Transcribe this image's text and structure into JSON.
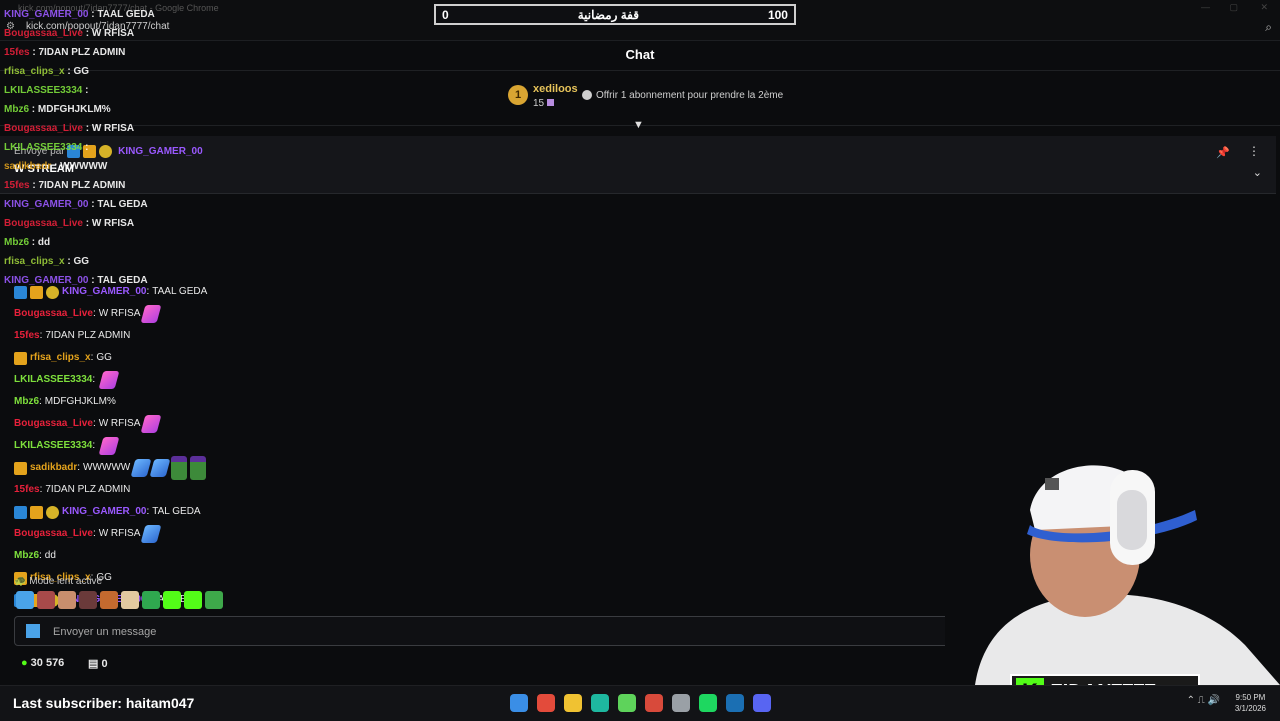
{
  "browser": {
    "title": "kick.com/popout/7idan7777/chat - Google Chrome",
    "url": "kick.com/popout/7idan7777/chat"
  },
  "goal": {
    "left": "0",
    "title": "قفة رمضانية",
    "right": "100"
  },
  "chat_header": {
    "title": "Chat"
  },
  "gift": {
    "rank": "1",
    "user": "xediloos",
    "count": "15",
    "info": "Offrir 1 abonnement pour prendre la 2ème"
  },
  "pinned": {
    "prefix": "Envoyé par",
    "user": "KING_GAMER_00",
    "message": "W STREAM"
  },
  "overlay_lines": [
    {
      "user": "KING_GAMER_00",
      "text": "TAAL GEDA",
      "color": "#9a59ff"
    },
    {
      "user": "Bougassaa_Live",
      "text": "W RFISA",
      "color": "#e8213b"
    },
    {
      "user": "15fes",
      "text": "7IDAN PLZ ADMIN",
      "color": "#e8213b"
    },
    {
      "user": "rfisa_clips_x",
      "text": "GG",
      "color": "#9dcf3b"
    },
    {
      "user": "LKILASSEE3334",
      "text": "",
      "color": "#7ee03c"
    },
    {
      "user": "Mbz6",
      "text": "MDFGHJKLM%",
      "color": "#7ee03c"
    },
    {
      "user": "Bougassaa_Live",
      "text": "W RFISA",
      "color": "#e8213b"
    },
    {
      "user": "LKILASSEE3334",
      "text": "",
      "color": "#7ee03c"
    },
    {
      "user": "sadikbadr",
      "text": "WWWWW",
      "color": "#e4a31c"
    },
    {
      "user": "15fes",
      "text": "7IDAN PLZ ADMIN",
      "color": "#e8213b"
    },
    {
      "user": "KING_GAMER_00",
      "text": "TAL GEDA",
      "color": "#9a59ff"
    },
    {
      "user": "Bougassaa_Live",
      "text": "W RFISA",
      "color": "#e8213b"
    },
    {
      "user": "Mbz6",
      "text": "dd",
      "color": "#7ee03c"
    },
    {
      "user": "rfisa_clips_x",
      "text": "GG",
      "color": "#9dcf3b"
    },
    {
      "user": "KING_GAMER_00",
      "text": "TAL GEDA",
      "color": "#9a59ff"
    }
  ],
  "messages": [
    {
      "user": "KING_GAMER_00",
      "text": "TAAL GEDA",
      "color": "#9a59ff",
      "badges": [
        "blue",
        "gold",
        "round"
      ],
      "emotes": []
    },
    {
      "user": "Bougassaa_Live",
      "text": "W RFISA",
      "color": "#e8213b",
      "badges": [],
      "emotes": [
        "pink"
      ]
    },
    {
      "user": "15fes",
      "text": "7IDAN PLZ ADMIN",
      "color": "#e8213b",
      "badges": [],
      "emotes": []
    },
    {
      "user": "rfisa_clips_x",
      "text": "GG",
      "color": "#e4a31c",
      "badges": [
        "gold"
      ],
      "emotes": []
    },
    {
      "user": "LKILASSEE3334",
      "text": "",
      "color": "#7ee03c",
      "badges": [],
      "emotes": [
        "pink"
      ]
    },
    {
      "user": "Mbz6",
      "text": "MDFGHJKLM%",
      "color": "#7ee03c",
      "badges": [],
      "emotes": []
    },
    {
      "user": "Bougassaa_Live",
      "text": "W RFISA",
      "color": "#e8213b",
      "badges": [],
      "emotes": [
        "pink"
      ]
    },
    {
      "user": "LKILASSEE3334",
      "text": "",
      "color": "#7ee03c",
      "badges": [],
      "emotes": [
        "pink"
      ]
    },
    {
      "user": "sadikbadr",
      "text": "WWWWW",
      "color": "#e4a31c",
      "badges": [
        "gold"
      ],
      "emotes": [
        "blue",
        "blue",
        "frog",
        "frog"
      ]
    },
    {
      "user": "15fes",
      "text": "7IDAN PLZ ADMIN",
      "color": "#e8213b",
      "badges": [],
      "emotes": []
    },
    {
      "user": "KING_GAMER_00",
      "text": "TAL GEDA",
      "color": "#9a59ff",
      "badges": [
        "blue",
        "gold",
        "round"
      ],
      "emotes": []
    },
    {
      "user": "Bougassaa_Live",
      "text": "W RFISA",
      "color": "#e8213b",
      "badges": [],
      "emotes": [
        "blue"
      ]
    },
    {
      "user": "Mbz6",
      "text": "dd",
      "color": "#7ee03c",
      "badges": [],
      "emotes": []
    },
    {
      "user": "rfisa_clips_x",
      "text": "GG",
      "color": "#e4a31c",
      "badges": [
        "gold"
      ],
      "emotes": []
    },
    {
      "user": "KING_GAMER_00",
      "text": "TAL GEDA",
      "color": "#9a59ff",
      "badges": [
        "blue",
        "gold",
        "round"
      ],
      "emotes": []
    }
  ],
  "slow_mode": "Mode lent activé",
  "emote_bar_colors": [
    "#4aa3e8",
    "#a84a4a",
    "#c98e6d",
    "#6a3a3a",
    "#c46a2f",
    "#e2c9a0",
    "#2fa84f",
    "#53fc18",
    "#53fc18",
    "#3ea84a"
  ],
  "input": {
    "placeholder": "Envoyer un message"
  },
  "footer": {
    "points": "30 576",
    "store": "0"
  },
  "stream": {
    "last_subscriber": "Last subscriber: haitam047",
    "channel_name": "7IDAN7777",
    "time": "9:50 PM",
    "date": "3/1/2026"
  },
  "taskbar_icon_colors": [
    "#3a8ee6",
    "#e34b3b",
    "#f0c232",
    "#1eb8a0",
    "#5ed35b",
    "#d84a3b",
    "#9aa0a6",
    "#1ed760",
    "#1b6fb3",
    "#5865f2"
  ],
  "colors": {
    "kick_green": "#53fc18",
    "background": "#0b0c0e"
  }
}
